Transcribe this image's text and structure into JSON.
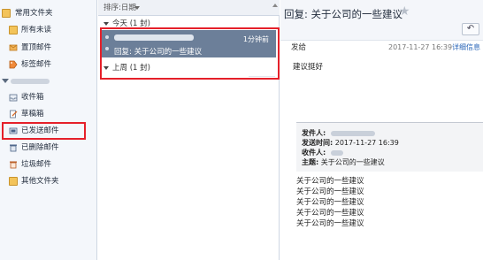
{
  "sidebar": {
    "common_folders": "常用文件夹",
    "shortcuts": [
      {
        "label": "所有未读",
        "icon": "folder-icon"
      },
      {
        "label": "置顶邮件",
        "icon": "pin-mail-icon"
      },
      {
        "label": "标签邮件",
        "icon": "tag-icon"
      }
    ],
    "folders": [
      {
        "label": "收件箱",
        "icon": "inbox-icon"
      },
      {
        "label": "草稿箱",
        "icon": "drafts-icon"
      },
      {
        "label": "已发送邮件",
        "icon": "sent-icon"
      },
      {
        "label": "已删除邮件",
        "icon": "trash-icon"
      },
      {
        "label": "垃圾邮件",
        "icon": "spam-icon"
      },
      {
        "label": "其他文件夹",
        "icon": "folder-icon"
      }
    ]
  },
  "list": {
    "sort_label": "排序:日期",
    "groups": [
      {
        "label": "今天 (1 封)"
      },
      {
        "label": "上周 (1 封)"
      }
    ],
    "item": {
      "time": "1分钟前",
      "subject": "回复: 关于公司的一些建议"
    }
  },
  "reader": {
    "title": "回复: 关于公司的一些建议",
    "star": "★",
    "reply_icon": "↶",
    "from_label": "发给",
    "date": "2017-11-27 16:39",
    "detail_link": "详细信息",
    "body": "建议挺好",
    "quote": {
      "from_label": "发件人:",
      "sent_label": "发送时间:",
      "sent_value": "2017-11-27 16:39",
      "to_label": "收件人:",
      "subject_label": "主题:",
      "subject_value": "关于公司的一些建议"
    },
    "quoted_lines": [
      "关于公司的一些建议",
      "关于公司的一些建议",
      "关于公司的一些建议",
      "关于公司的一些建议",
      "关于公司的一些建议"
    ]
  },
  "colors": {
    "highlight": "#e5202a",
    "selected_item": "#6c7f99"
  }
}
